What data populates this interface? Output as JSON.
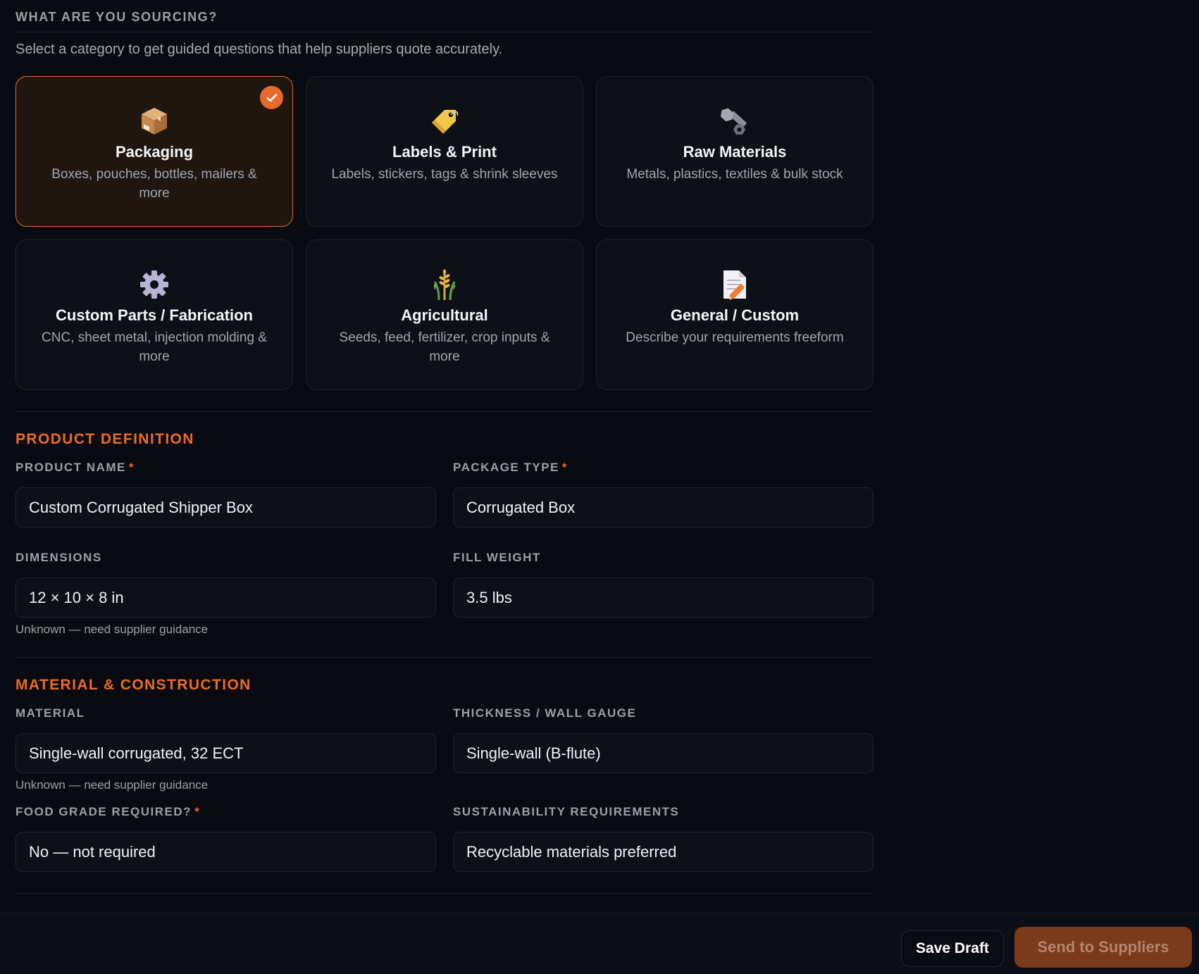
{
  "sourcing": {
    "heading": "WHAT ARE YOU SOURCING?",
    "subtitle": "Select a category to get guided questions that help suppliers quote accurately.",
    "categories": [
      {
        "title": "Packaging",
        "desc": "Boxes, pouches, bottles, mailers & more",
        "icon": "package-icon",
        "selected": true
      },
      {
        "title": "Labels & Print",
        "desc": "Labels, stickers, tags & shrink sleeves",
        "icon": "tag-icon",
        "selected": false
      },
      {
        "title": "Raw Materials",
        "desc": "Metals, plastics, textiles & bulk stock",
        "icon": "nut-bolt-icon",
        "selected": false
      },
      {
        "title": "Custom Parts / Fabrication",
        "desc": "CNC, sheet metal, injection molding & more",
        "icon": "gear-icon",
        "selected": false
      },
      {
        "title": "Agricultural",
        "desc": "Seeds, feed, fertilizer, crop inputs & more",
        "icon": "wheat-icon",
        "selected": false
      },
      {
        "title": "General / Custom",
        "desc": "Describe your requirements freeform",
        "icon": "memo-icon",
        "selected": false
      }
    ]
  },
  "product_definition": {
    "heading": "PRODUCT DEFINITION",
    "product_name": {
      "label": "PRODUCT NAME",
      "required_mark": "*",
      "value": "Custom Corrugated Shipper Box"
    },
    "package_type": {
      "label": "PACKAGE TYPE",
      "required_mark": "*",
      "value": "Corrugated Box"
    },
    "dimensions": {
      "label": "DIMENSIONS",
      "value": "12 × 10 × 8 in",
      "hint": "Unknown — need supplier guidance"
    },
    "fill_weight": {
      "label": "FILL WEIGHT",
      "value": "3.5 lbs"
    }
  },
  "material_construction": {
    "heading": "MATERIAL & CONSTRUCTION",
    "material": {
      "label": "MATERIAL",
      "value": "Single-wall corrugated, 32 ECT",
      "hint": "Unknown — need supplier guidance"
    },
    "thickness": {
      "label": "THICKNESS / WALL GAUGE",
      "value": "Single-wall (B-flute)"
    },
    "food_grade": {
      "label": "FOOD GRADE REQUIRED?",
      "required_mark": "*",
      "value": "No — not required"
    },
    "sustainability": {
      "label": "SUSTAINABILITY REQUIREMENTS",
      "value": "Recyclable materials preferred"
    }
  },
  "footer": {
    "save_draft": "Save Draft",
    "send": "Send to Suppliers"
  },
  "colors": {
    "accent": "#ef6a24",
    "background": "#090b10",
    "card": "#0d1016",
    "selected_card": "#1f1610"
  }
}
